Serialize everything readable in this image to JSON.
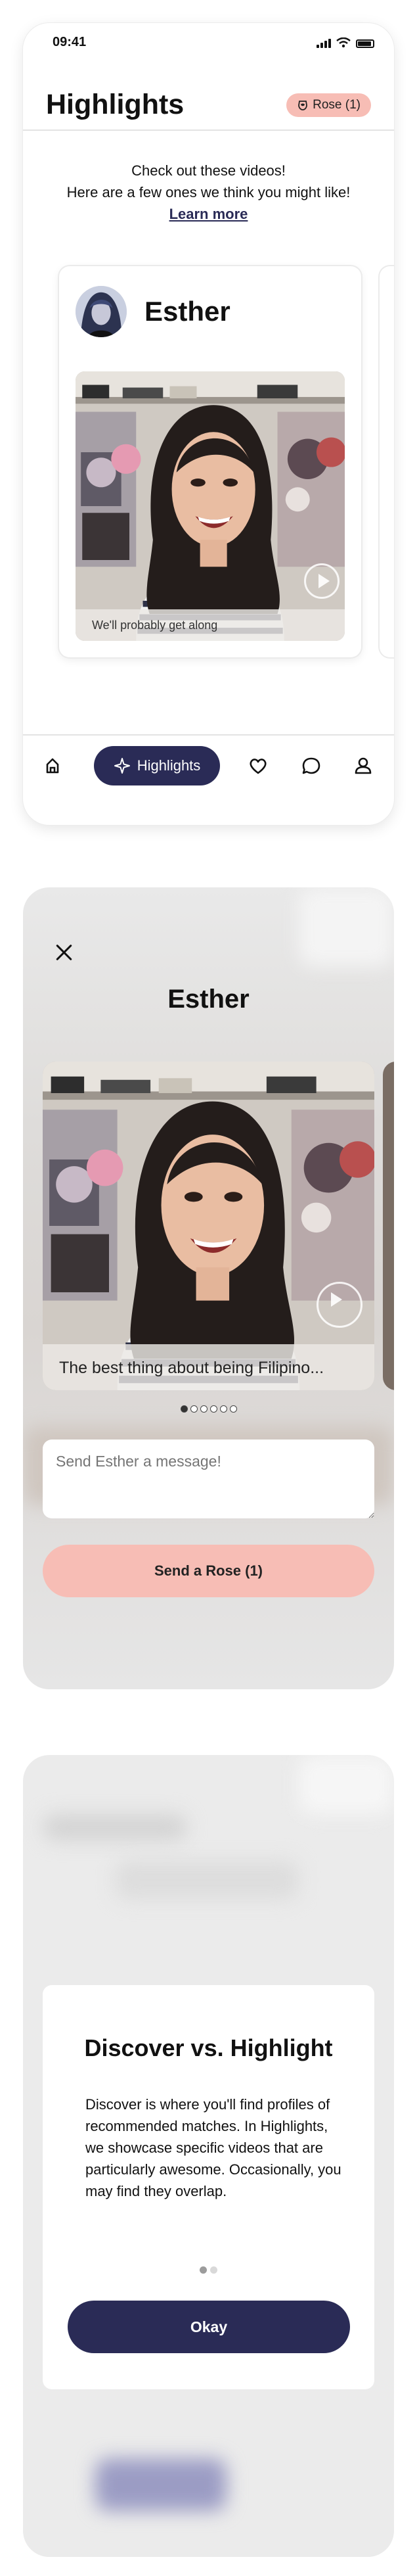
{
  "colors": {
    "brand_navy": "#2a2b56",
    "rose_pink": "#f7bdb5",
    "divider": "#e3e3e3"
  },
  "highlights_screen": {
    "status_time": "09:41",
    "title": "Highlights",
    "rose_badge": "Rose (1)",
    "intro_line1": "Check out these videos!",
    "intro_line2": "Here are a few ones we think you might like!",
    "learn_more": "Learn more",
    "card": {
      "name": "Esther",
      "caption": "We'll probably get along"
    },
    "tabs": [
      {
        "icon": "home-icon",
        "label": ""
      },
      {
        "icon": "sparkle-icon",
        "label": "Highlights",
        "active": true
      },
      {
        "icon": "heart-icon",
        "label": ""
      },
      {
        "icon": "chat-bubble-icon",
        "label": ""
      },
      {
        "icon": "profile-icon",
        "label": ""
      }
    ]
  },
  "detail_screen": {
    "name": "Esther",
    "caption": "The best thing about being Filipino...",
    "pagination": {
      "count": 6,
      "active": 0
    },
    "message_placeholder": "Send Esther a message!",
    "send_button": "Send a Rose (1)"
  },
  "info_modal": {
    "title": "Discover vs. Highlight",
    "body": "Discover is where you'll find profiles of recommended matches. In Highlights, we showcase specific videos that are particularly awesome. Occasionally, you may find they overlap.",
    "pagination": {
      "count": 2,
      "active": 0
    },
    "okay_button": "Okay"
  }
}
